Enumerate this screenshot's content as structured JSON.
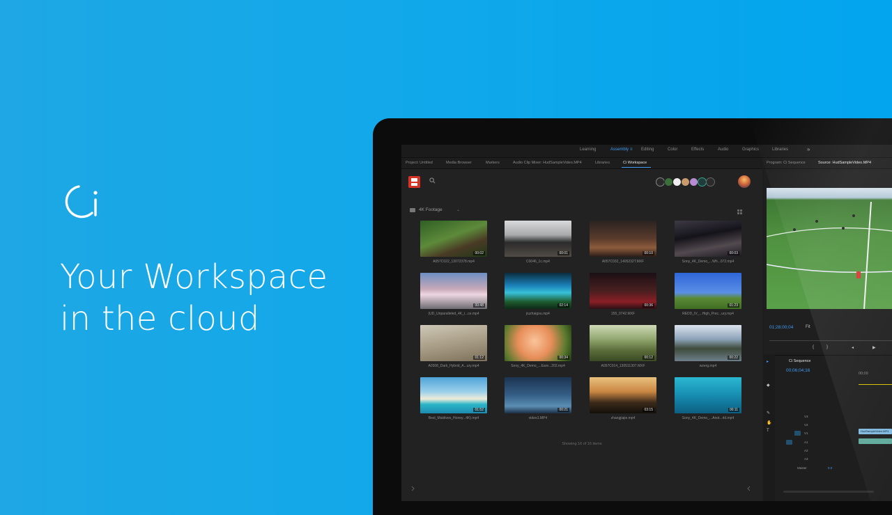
{
  "hero": {
    "logo_icon": "ci-logo-icon",
    "title_line1": "Your Workspace",
    "title_line2": "in the cloud"
  },
  "workspaces": {
    "items": [
      "Learning",
      "Assembly",
      "Editing",
      "Color",
      "Effects",
      "Audio",
      "Graphics",
      "Libraries"
    ],
    "active": "Assembly",
    "more": "»"
  },
  "left_tabs": [
    "Project: Untitled",
    "Media Browser",
    "Markers",
    "Audio Clip Mixer: HudSampleVideo.MP4",
    "Libraries",
    "Ci Workspace"
  ],
  "right_tabs": [
    "Program: Ci Sequence",
    "Source: HudSampleVideo.MP4"
  ],
  "ci_panel": {
    "folder_label": "4K Footage",
    "folder_caret": "⌄",
    "tiles": [
      {
        "name": "A057C022_13072378.mp4",
        "duration": "00:02"
      },
      {
        "name": "C0046_1c.mp4",
        "duration": "00:01"
      },
      {
        "name": "A057C032_1405232T.MXF",
        "duration": "00:10"
      },
      {
        "name": "Sony_4K_Demo_...Wh...072.mp4",
        "duration": "00:03"
      },
      {
        "name": "(UD_Unparalleled_4K_i...ce.mp4",
        "duration": "00:48"
      },
      {
        "name": "jiuzhaigou.mp4",
        "duration": "02:14"
      },
      {
        "name": "155_0742.MXF",
        "duration": "00:36"
      },
      {
        "name": "REDD_IV_...High_Prec...ury.mp4",
        "duration": "01:23"
      },
      {
        "name": "A0308_Dark_Hybrid_A...ury.mp4",
        "duration": "01:12"
      },
      {
        "name": "Sony_4K_Demo_...Eare...202.mp4",
        "duration": "00:34"
      },
      {
        "name": "A057C014_130511307.MXF",
        "duration": "00:12"
      },
      {
        "name": "wzerg.mp4",
        "duration": "00:22"
      },
      {
        "name": "Best_Maldives_Honey...4K).mp4",
        "duration": "01:52"
      },
      {
        "name": "video1.MP4",
        "duration": "00:21"
      },
      {
        "name": "zhangjiajie.mp4",
        "duration": "03:15"
      },
      {
        "name": "Sony_4K_Demo_...Anot...rld.mp4",
        "duration": "00:11"
      }
    ],
    "showing": "Showing 16 of 16 items"
  },
  "program": {
    "timecode": "01;28;00;04",
    "fit_label": "Fit"
  },
  "timeline": {
    "sequence": "Ci Sequence",
    "timecode": "00;06;04;16",
    "ruler_label": "00;00",
    "tracks": [
      "V3",
      "V2",
      "V1",
      "A1",
      "A2",
      "A3"
    ],
    "master_label": "Master",
    "master_value": "0.0",
    "clip_name": "HudSampleVideo.MP4"
  },
  "colors": {
    "accent": "#3f9cf1",
    "save_red": "#d63327",
    "background": "#10a8ea"
  }
}
